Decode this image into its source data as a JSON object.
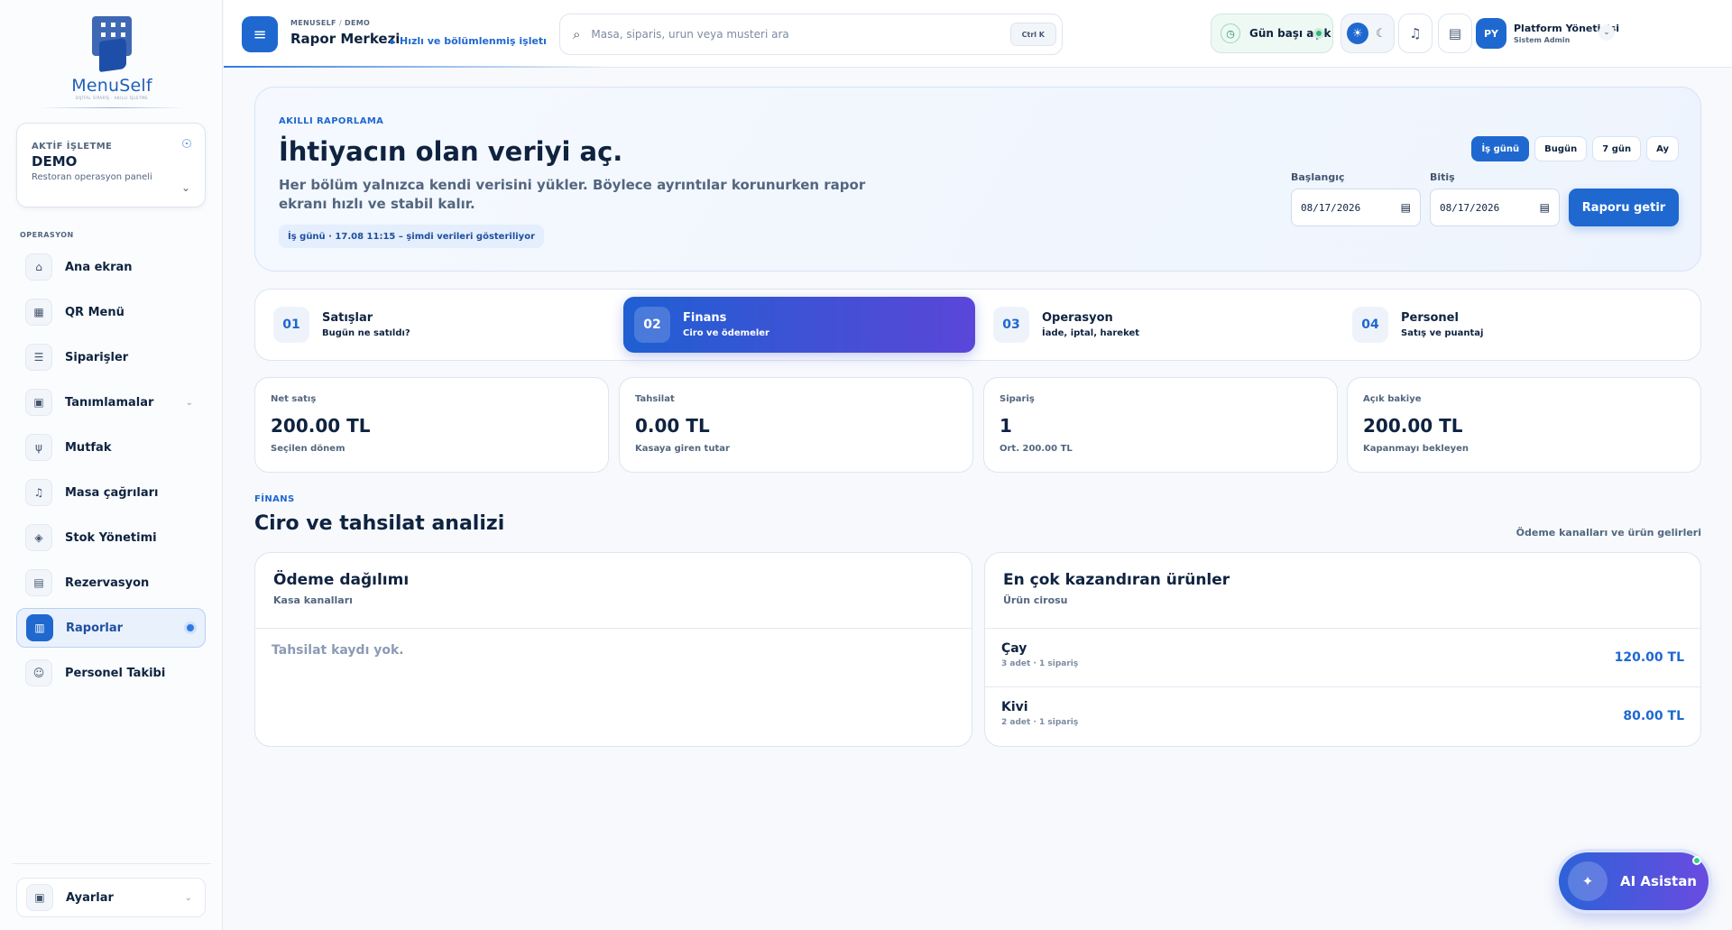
{
  "brand": {
    "name": "MenuSelf",
    "tagline": "DİJİTAL SİPARİŞ · AKILLI İŞLETME"
  },
  "business": {
    "label": "AKTİF İŞLETME",
    "name": "DEMO",
    "desc": "Restoran operasyon paneli"
  },
  "sidebar": {
    "section": "OPERASYON",
    "items": [
      {
        "label": "Ana ekran",
        "icon": "home-icon",
        "glyph": "⌂"
      },
      {
        "label": "QR Menü",
        "icon": "qr-icon",
        "glyph": "▦"
      },
      {
        "label": "Siparişler",
        "icon": "receipt-icon",
        "glyph": "☰"
      },
      {
        "label": "Tanımlamalar",
        "icon": "grid-icon",
        "glyph": "▣"
      },
      {
        "label": "Mutfak",
        "icon": "utensils-icon",
        "glyph": "ψ"
      },
      {
        "label": "Masa çağrıları",
        "icon": "bell-icon",
        "glyph": "♫"
      },
      {
        "label": "Stok Yönetimi",
        "icon": "layers-icon",
        "glyph": "◈"
      },
      {
        "label": "Rezervasyon",
        "icon": "calendar-icon",
        "glyph": "▤"
      },
      {
        "label": "Raporlar",
        "icon": "chart-icon",
        "glyph": "▥"
      },
      {
        "label": "Personel Takibi",
        "icon": "users-icon",
        "glyph": "☺"
      }
    ],
    "settings": "Ayarlar"
  },
  "header": {
    "crumb_root": "MENUSELF",
    "crumb_leaf": "DEMO",
    "title": "Rapor Merkezi",
    "subtitle": "Hızlı ve bölümlenmiş işletı",
    "search_placeholder": "Masa, siparis, urun veya musteri ara",
    "shortcut": "Ctrl K",
    "day_status": "Gün başı açık",
    "user_initials": "PY",
    "user_name": "Platform Yöneticisi",
    "user_role": "Sistem Admin"
  },
  "hero": {
    "kicker": "AKILLI RAPORLAMA",
    "title": "İhtiyacın olan veriyi aç.",
    "desc": "Her bölüm yalnızca kendi verisini yükler. Böylece ayrıntılar korunurken rapor ekranı hızlı ve stabil kalır.",
    "chip": "İş günü · 17.08 11:15 – şimdi verileri gösteriliyor",
    "presets": [
      "İş günü",
      "Bugün",
      "7 gün",
      "Ay"
    ],
    "start_label": "Başlangıç",
    "end_label": "Bitiş",
    "start_value": "08/17/2026",
    "end_value": "08/17/2026",
    "submit": "Raporu getir"
  },
  "tabs": [
    {
      "num": "01",
      "title": "Satışlar",
      "sub": "Bugün ne satıldı?"
    },
    {
      "num": "02",
      "title": "Finans",
      "sub": "Ciro ve ödemeler"
    },
    {
      "num": "03",
      "title": "Operasyon",
      "sub": "İade, iptal, hareket"
    },
    {
      "num": "04",
      "title": "Personel",
      "sub": "Satış ve puantaj"
    }
  ],
  "kpis": [
    {
      "label": "Net satış",
      "value": "200.00 TL",
      "note": "Seçilen dönem"
    },
    {
      "label": "Tahsilat",
      "value": "0.00 TL",
      "note": "Kasaya giren tutar"
    },
    {
      "label": "Sipariş",
      "value": "1",
      "note": "Ort. 200.00 TL"
    },
    {
      "label": "Açık bakiye",
      "value": "200.00 TL",
      "note": "Kapanmayı bekleyen"
    }
  ],
  "section": {
    "kicker": "FİNANS",
    "title": "Ciro ve tahsilat analizi",
    "right": "Ödeme kanalları ve ürün gelirleri"
  },
  "payments": {
    "title": "Ödeme dağılımı",
    "sub": "Kasa kanalları",
    "empty": "Tahsilat kaydı yok."
  },
  "products": {
    "title": "En çok kazandıran ürünler",
    "sub": "Ürün cirosu",
    "rows": [
      {
        "name": "Çay",
        "meta": "3 adet · 1 sipariş",
        "value": "120.00 TL"
      },
      {
        "name": "Kivi",
        "meta": "2 adet · 1 sipariş",
        "value": "80.00 TL"
      }
    ]
  },
  "assistant": {
    "label": "AI Asistan"
  }
}
